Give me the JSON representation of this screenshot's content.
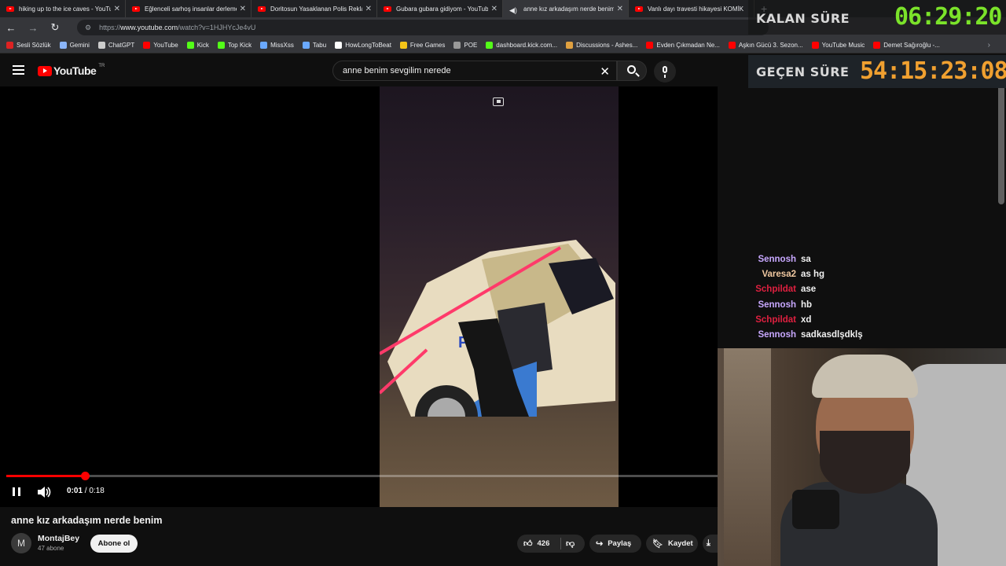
{
  "browser": {
    "tabs": [
      {
        "title": "hiking up to the ice caves - YouTube",
        "active": false,
        "icon": "youtube"
      },
      {
        "title": "Eğlenceli sarhoş insanlar derlemesi",
        "active": false,
        "icon": "youtube"
      },
      {
        "title": "Doritosun Yasaklanan Polis Reklamı",
        "active": false,
        "icon": "youtube"
      },
      {
        "title": "Gubara gubara gidiyom - YouTube",
        "active": false,
        "icon": "youtube"
      },
      {
        "title": "anne kız arkadaşım nerde benim",
        "active": true,
        "icon": "audio"
      },
      {
        "title": "Vanlı dayı travesti hikayesi KOMİK",
        "active": false,
        "icon": "youtube"
      }
    ],
    "url_prefix": "https://",
    "url_host": "www.youtube.com",
    "url_path": "/watch?v=1HJHYcJe4vU",
    "bookmarks": [
      {
        "label": "Sesli Sözlük",
        "color": "#d22"
      },
      {
        "label": "Gemini",
        "color": "#8ab4f8"
      },
      {
        "label": "ChatGPT",
        "color": "#ccc"
      },
      {
        "label": "YouTube",
        "color": "#f00"
      },
      {
        "label": "Kick",
        "color": "#53fc18"
      },
      {
        "label": "Top Kick",
        "color": "#53fc18"
      },
      {
        "label": "MissXss",
        "color": "#6aa9ff"
      },
      {
        "label": "Tabu",
        "color": "#6aa9ff"
      },
      {
        "label": "HowLongToBeat",
        "color": "#fff"
      },
      {
        "label": "Free Games",
        "color": "#f5c518"
      },
      {
        "label": "POE",
        "color": "#999"
      },
      {
        "label": "dashboard.kick.com...",
        "color": "#53fc18"
      },
      {
        "label": "Discussions - Ashes...",
        "color": "#e0a040"
      },
      {
        "label": "Evden Çıkmadan Ne...",
        "color": "#f00"
      },
      {
        "label": "Aşkın Gücü 3. Sezon...",
        "color": "#f00"
      },
      {
        "label": "YouTube Music",
        "color": "#f00"
      },
      {
        "label": "Demet Sağıroğlu -...",
        "color": "#f00"
      }
    ]
  },
  "youtube": {
    "logo_text": "YouTube",
    "region": "TR",
    "search_value": "anne benim sevgilim nerede",
    "player": {
      "current_time": "0:01",
      "duration": "0:18",
      "time_separator": " / ",
      "progress_fraction": 0.11
    },
    "video_title": "anne kız arkadaşım nerde benim",
    "channel": {
      "avatar_letter": "M",
      "name": "MontajBey",
      "subs": "47 abone"
    },
    "subscribe_label": "Abone ol",
    "likes": "426",
    "share_label": "Paylaş",
    "save_label": "Kaydet"
  },
  "overlay": {
    "remaining_label": "KALAN SÜRE",
    "remaining_value": "06:29:20",
    "elapsed_label": "GEÇEN SÜRE",
    "elapsed_value": "54:15:23:08",
    "remaining_color": "#7be32a",
    "elapsed_color": "#f0a030"
  },
  "chat": [
    {
      "user": "Sennosh",
      "msg": "sa",
      "color": "#c8a8ff"
    },
    {
      "user": "Varesa2",
      "msg": "as hg",
      "color": "#f0c8a0"
    },
    {
      "user": "Schpildat",
      "msg": "ase",
      "color": "#e02040"
    },
    {
      "user": "Sennosh",
      "msg": "hb",
      "color": "#c8a8ff"
    },
    {
      "user": "Schpildat",
      "msg": "xd",
      "color": "#e02040"
    },
    {
      "user": "Sennosh",
      "msg": "sadkasdlşdklş",
      "color": "#c8a8ff"
    }
  ]
}
